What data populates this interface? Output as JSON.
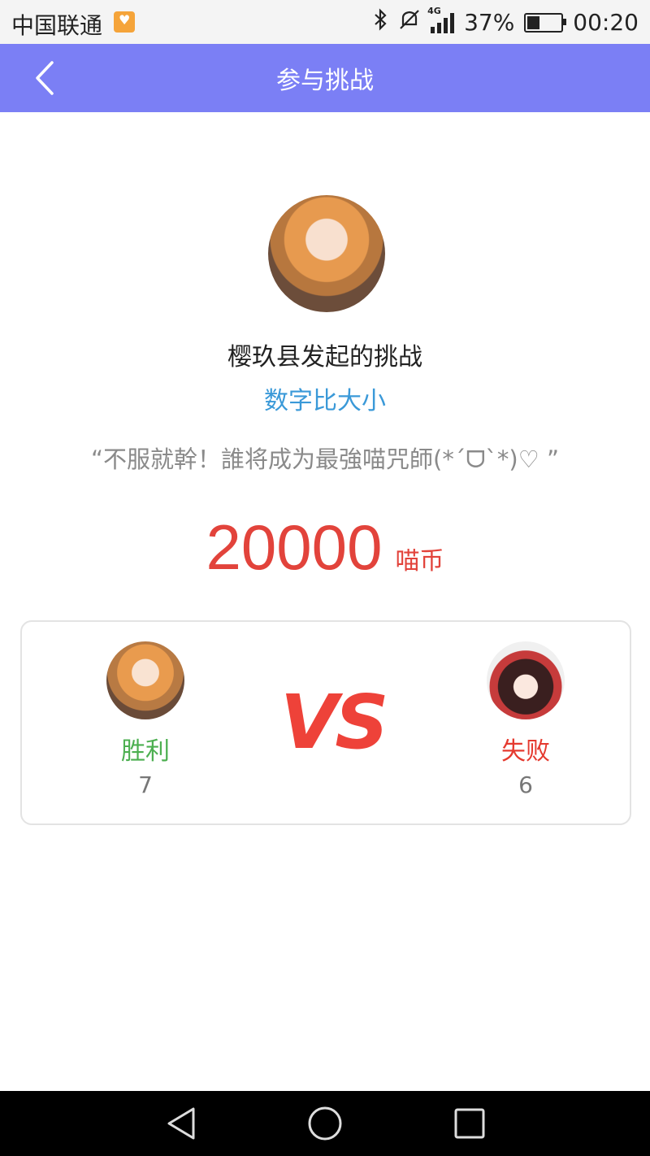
{
  "status_bar": {
    "carrier": "中国联通",
    "battery": "37%",
    "battery_level": 0.37,
    "time": "00:20",
    "network": "4G"
  },
  "header": {
    "title": "参与挑战"
  },
  "challenge": {
    "challenger_text": "樱玖县发起的挑战",
    "game_type": "数字比大小",
    "slogan": "“不服就幹！誰将成为最強喵咒師(*ˊᗜˋ*)♡ ”",
    "reward_amount": "20000",
    "reward_unit": "喵币"
  },
  "versus": {
    "vs_label": "VS",
    "left_player": {
      "result": "胜利",
      "count": "7"
    },
    "right_player": {
      "result": "失败",
      "count": "6"
    }
  },
  "colors": {
    "header_bg": "#7b7ff5",
    "accent_blue": "#3a99d8",
    "accent_red": "#e2433b",
    "win_green": "#4caf50"
  }
}
